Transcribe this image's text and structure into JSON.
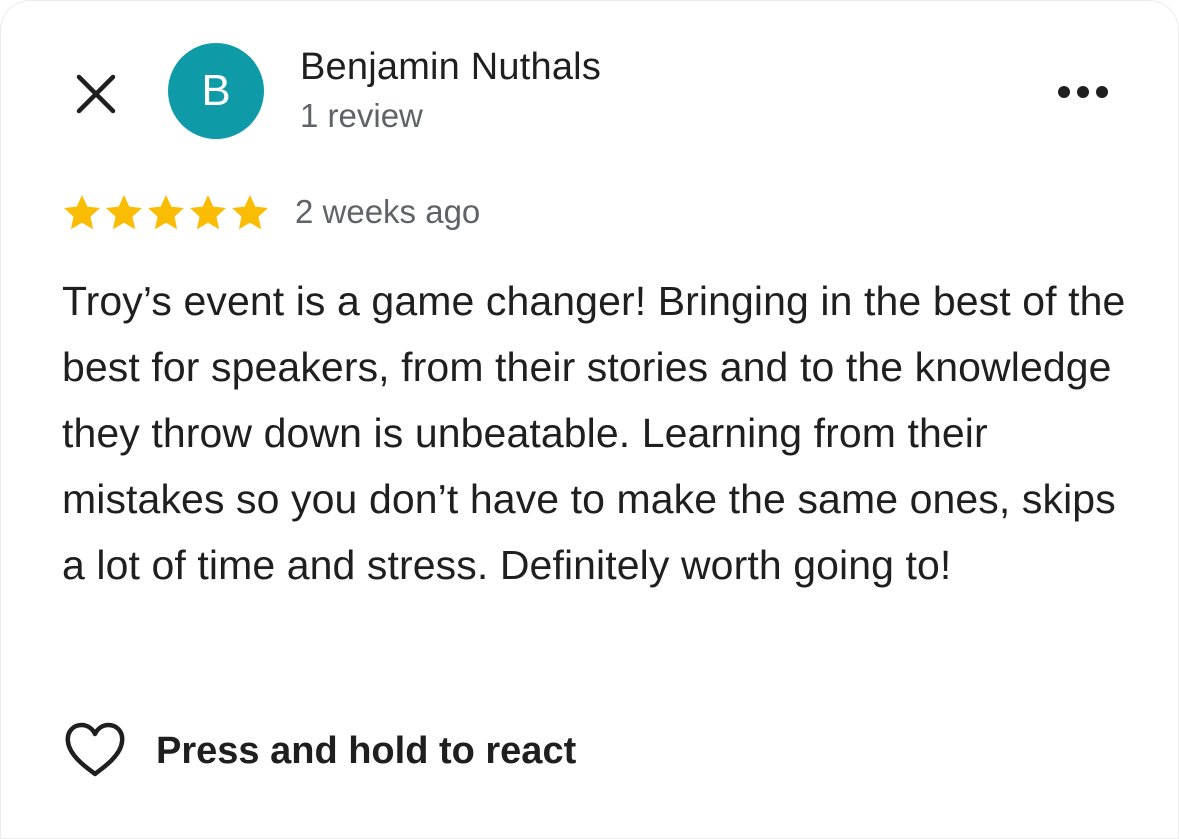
{
  "header": {
    "close_icon": "close-icon",
    "avatar_letter": "B",
    "avatar_color": "#0e9aa7",
    "author_name": "Benjamin Nuthals",
    "review_count": "1 review",
    "more_icon": "more-horizontal-icon"
  },
  "review": {
    "rating": 5,
    "rating_max": 5,
    "star_color": "#fbbc04",
    "time_ago": "2 weeks ago",
    "text": "Troy’s event is a game changer! Bringing in the best of the best for speakers, from their stories and to the knowledge they throw down is unbeatable. Learning from their mistakes so you don’t have to make the same ones, skips a lot of time and stress. Definitely worth going to!"
  },
  "reaction": {
    "icon": "heart-outline-icon",
    "label": "Press and hold to react"
  }
}
